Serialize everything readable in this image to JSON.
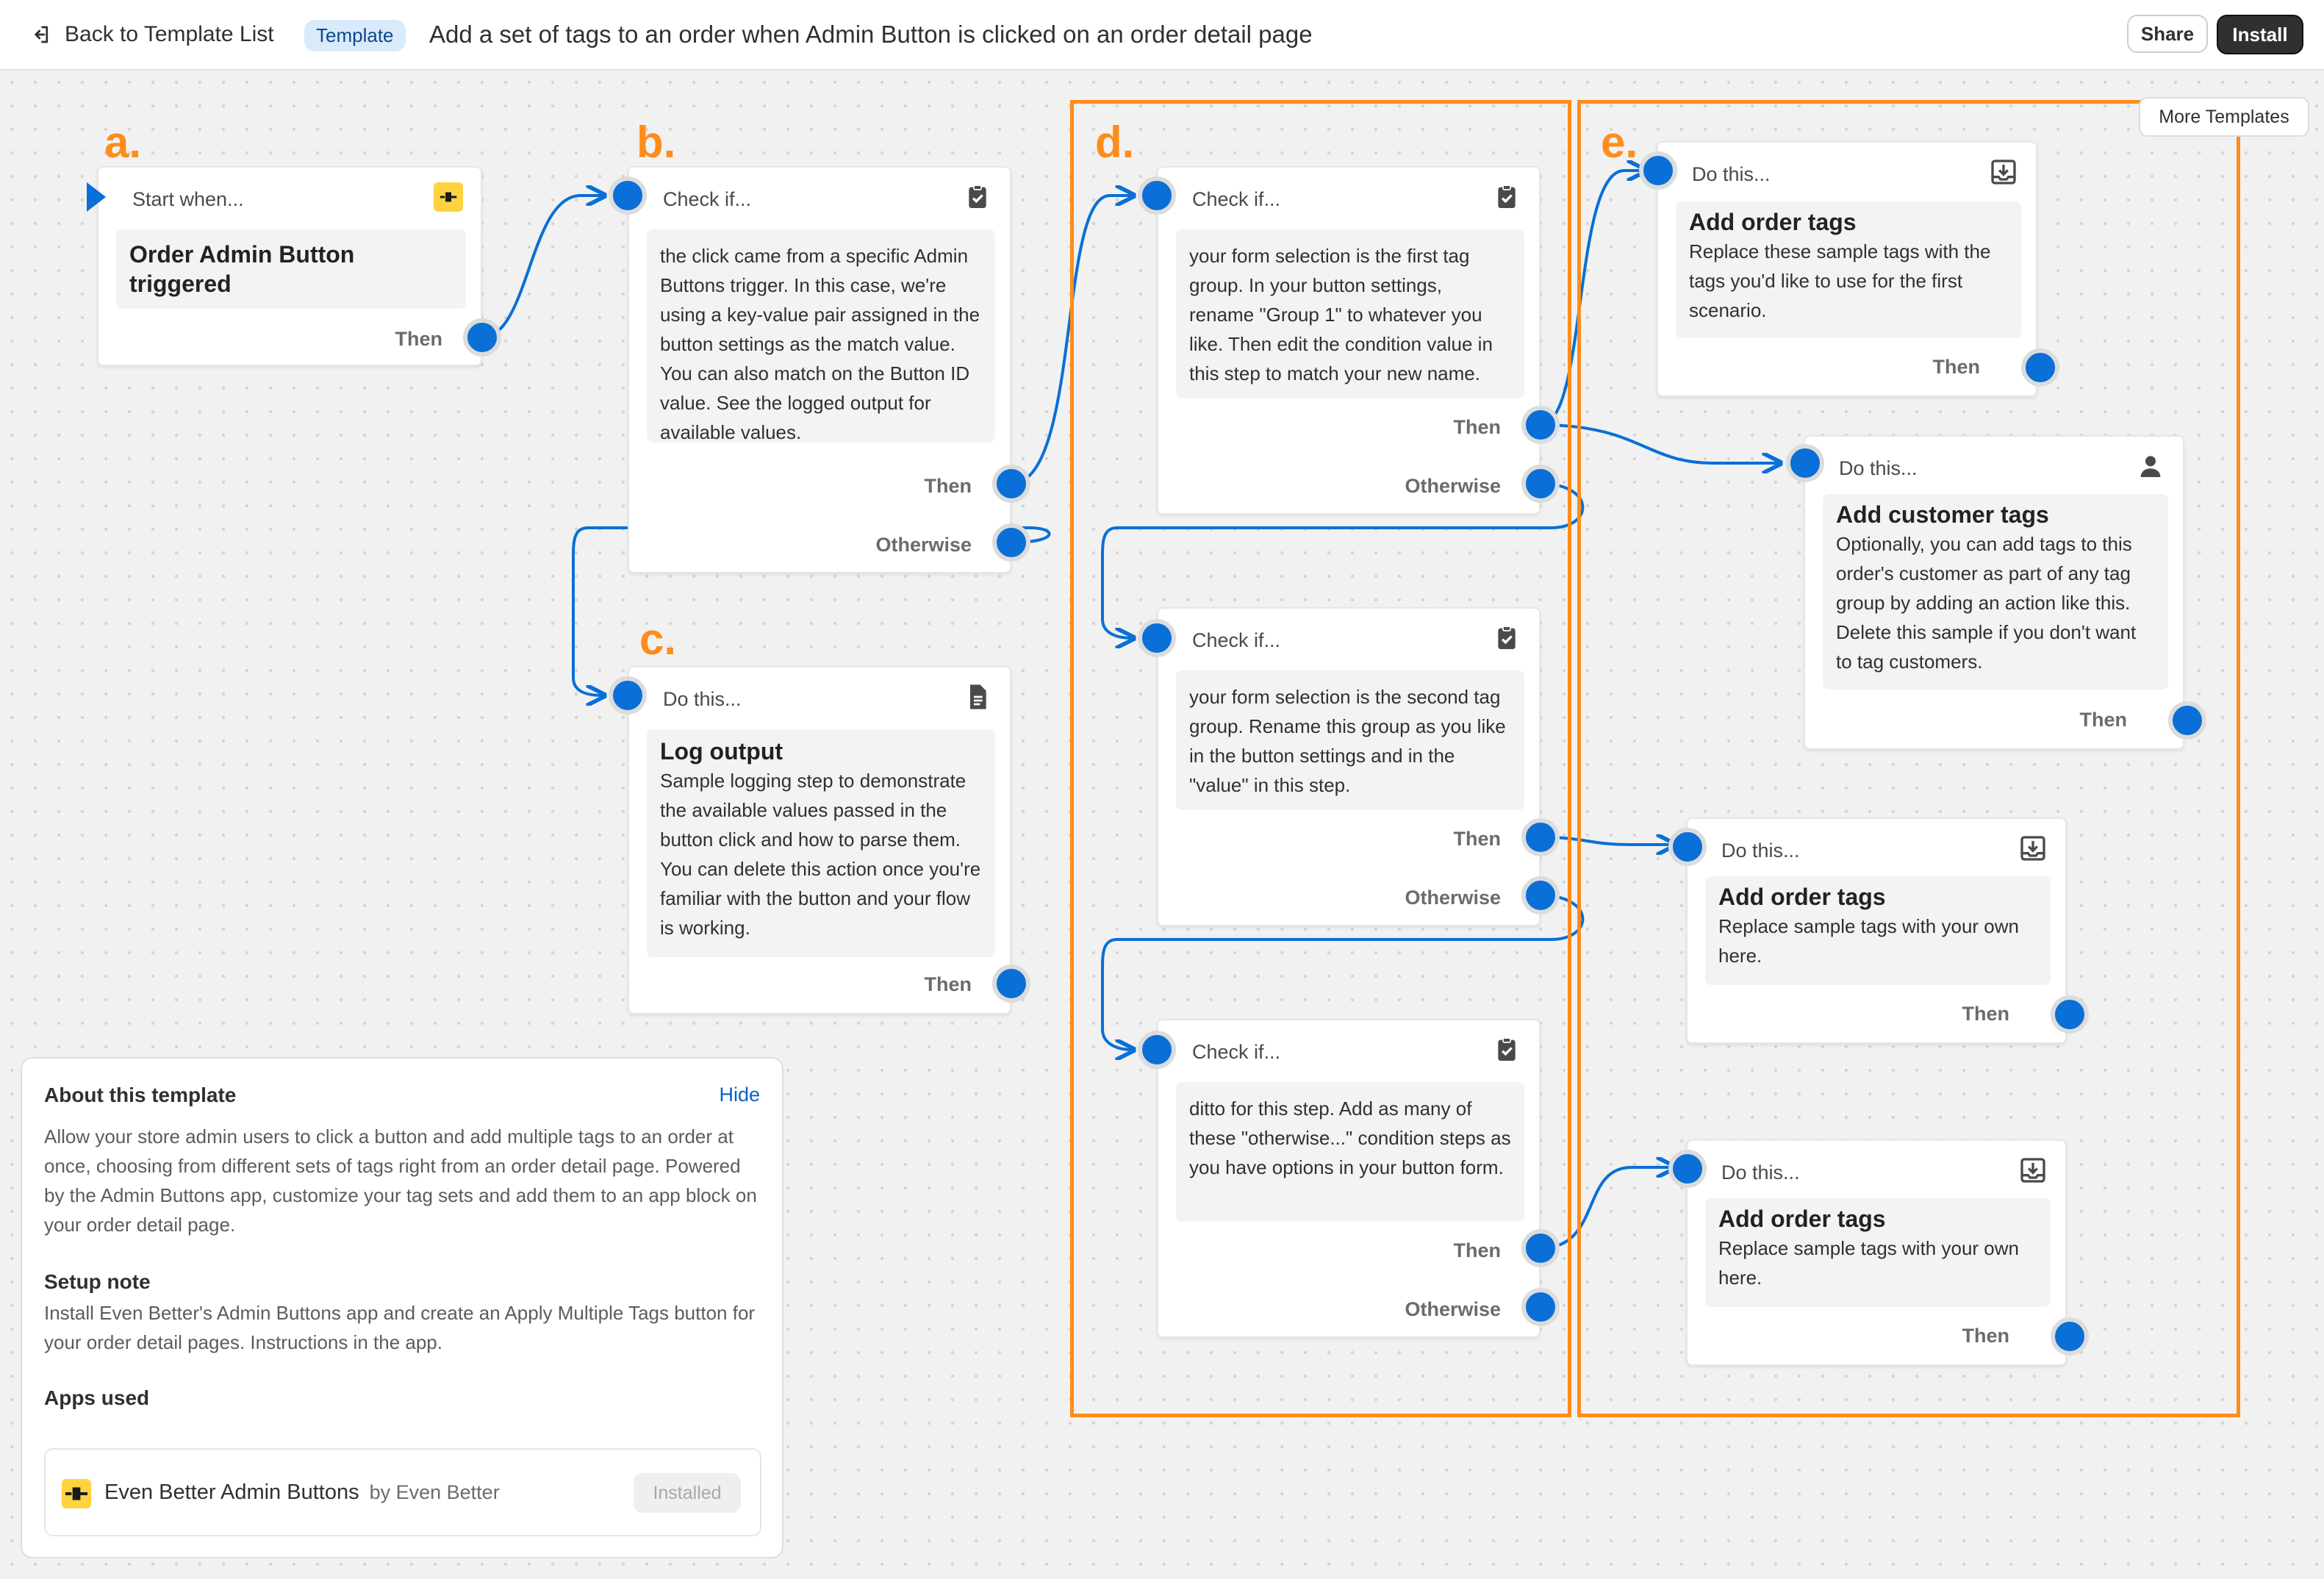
{
  "header": {
    "back_label": "Back to Template List",
    "badge": "Template",
    "title": "Add a set of tags to an order when Admin Button is clicked on an order detail page",
    "share_label": "Share",
    "install_label": "Install",
    "more_templates_label": "More Templates"
  },
  "annotations": {
    "a": "a.",
    "b": "b.",
    "c": "c.",
    "d": "d.",
    "e": "e."
  },
  "colors": {
    "accent": "#0a6fd6",
    "annotation": "#ff8c1a",
    "app_icon": "#ffd23f"
  },
  "nodes": {
    "start": {
      "head": "Start when...",
      "icon": "plug-icon",
      "title": "Order Admin Button triggered",
      "then": "Then"
    },
    "check1": {
      "head": "Check if...",
      "icon": "clipboard-check-icon",
      "text": "the click came from a specific Admin Buttons trigger. In this case, we're using a key-value pair assigned in the button settings as the match value. You can also match on the Button ID value. See the logged output for available values.",
      "then": "Then",
      "otherwise": "Otherwise"
    },
    "log": {
      "head": "Do this...",
      "icon": "document-icon",
      "title": "Log output",
      "text": "Sample logging step to demonstrate the available values passed in the button click and how to parse them. You can delete this action once you're familiar with the button and your flow is working.",
      "then": "Then"
    },
    "check2": {
      "head": "Check if...",
      "icon": "clipboard-check-icon",
      "text": "your form selection is the first tag group. In your button settings, rename \"Group 1\" to whatever you like. Then edit the condition value in this step to match your new name.",
      "then": "Then",
      "otherwise": "Otherwise"
    },
    "check3": {
      "head": "Check if...",
      "icon": "clipboard-check-icon",
      "text": "your form selection is the second tag group. Rename this group as you like in the button settings and in the \"value\" in this step.",
      "then": "Then",
      "otherwise": "Otherwise"
    },
    "check4": {
      "head": "Check if...",
      "icon": "clipboard-check-icon",
      "text": "ditto for this step. Add as many of these \"otherwise...\" condition steps as you have options in your button form.",
      "then": "Then",
      "otherwise": "Otherwise"
    },
    "order1": {
      "head": "Do this...",
      "icon": "tray-download-icon",
      "title": "Add order tags",
      "text": "Replace these sample tags with the tags you'd like to use for the first scenario.",
      "then": "Then"
    },
    "customer": {
      "head": "Do this...",
      "icon": "person-icon",
      "title": "Add customer tags",
      "text": "Optionally, you can add tags to this order's customer as part of any tag group by adding an action like this. Delete this sample if you don't want to tag customers.",
      "then": "Then"
    },
    "order2": {
      "head": "Do this...",
      "icon": "tray-download-icon",
      "title": "Add order tags",
      "text": "Replace sample tags with your own here.",
      "then": "Then"
    },
    "order3": {
      "head": "Do this...",
      "icon": "tray-download-icon",
      "title": "Add order tags",
      "text": "Replace sample tags with your own here.",
      "then": "Then"
    }
  },
  "about": {
    "title": "About this template",
    "hide_label": "Hide",
    "description": "Allow your store admin users to click a button and add multiple tags to an order at once, choosing from different sets of tags right from an order detail page. Powered by the Admin Buttons app, customize your tag sets and add them to an app block on your order detail page.",
    "setup_title": "Setup note",
    "setup_text": "Install Even Better's Admin Buttons app and create an Apply Multiple Tags button for your order detail pages. Instructions in the app.",
    "apps_title": "Apps used",
    "app_name": "Even Better Admin Buttons",
    "app_by": "by Even Better",
    "app_status": "Installed"
  }
}
